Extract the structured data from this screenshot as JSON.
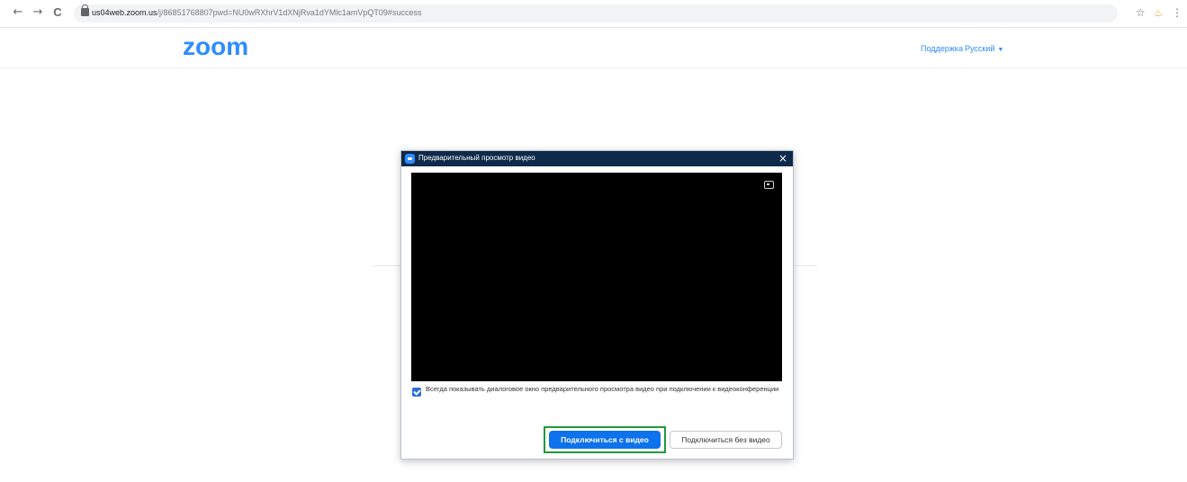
{
  "browser": {
    "url_host": "us04web.zoom.us",
    "url_rest": "/j/86851768807pwd=NU0wRXhrV1dXNjRva1dYMlc1amVpQT09#success",
    "back_icon": "←",
    "forward_icon": "→",
    "reload_icon": "C",
    "star_icon": "☆",
    "extension_icon": "♨",
    "menu_icon": "⋮"
  },
  "header": {
    "logo": "zoom",
    "support_link": "Поддержка",
    "language": "Русский",
    "language_caret": "▼"
  },
  "dialog": {
    "title": "Предварительный просмотр видео",
    "close": "×",
    "checkbox_label": "Всегда показывать диалоговое окно предварительного просмотра видео при подключении к видеоконференции",
    "checkbox_checked": true,
    "join_with_video": "Подключиться с видео",
    "join_without_video": "Подключиться без видео"
  },
  "colors": {
    "brand": "#2d8cff",
    "titlebar": "#0e2a4a",
    "primary_button": "#0e72ed",
    "highlight": "#1f9a3a"
  }
}
